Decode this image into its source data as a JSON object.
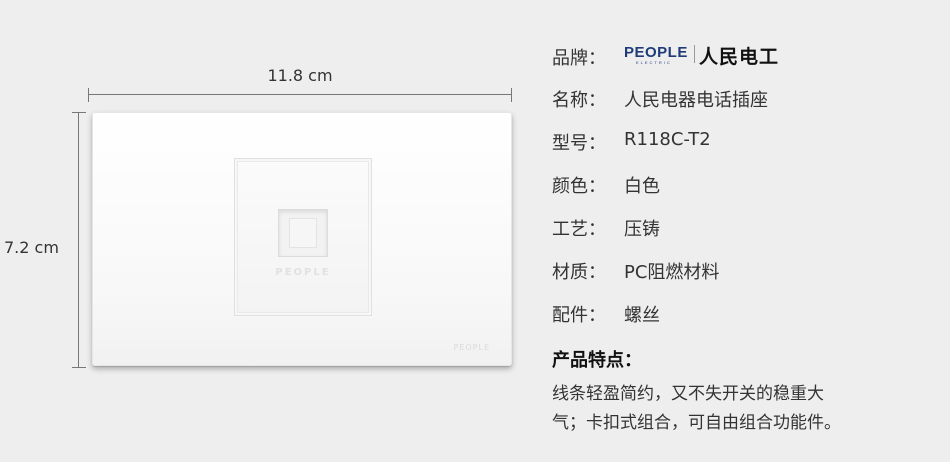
{
  "dimensions": {
    "width_label": "11.8 cm",
    "height_label": "7.2 cm"
  },
  "product_marks": {
    "module_text": "PEOPLE",
    "panel_text": "PEOPLE"
  },
  "brand": {
    "label": "品牌：",
    "logo_en": "PEOPLE",
    "logo_sub": "ELECTRIC",
    "logo_cn": "人民电工"
  },
  "specs": [
    {
      "label": "名称：",
      "value": "人民电器电话插座"
    },
    {
      "label": "型号：",
      "value": "R118C-T2"
    },
    {
      "label": "颜色：",
      "value": "白色"
    },
    {
      "label": "工艺：",
      "value": "压铸"
    },
    {
      "label": "材质：",
      "value": "PC阻燃材料"
    },
    {
      "label": "配件：",
      "value": "螺丝"
    }
  ],
  "features": {
    "title": "产品特点：",
    "line1": "线条轻盈简约，又不失开关的稳重大",
    "line2": "气；卡扣式组合，可自由组合功能件。"
  },
  "colors": {
    "background": "#eeeeee",
    "brand_blue": "#1f3c78"
  }
}
